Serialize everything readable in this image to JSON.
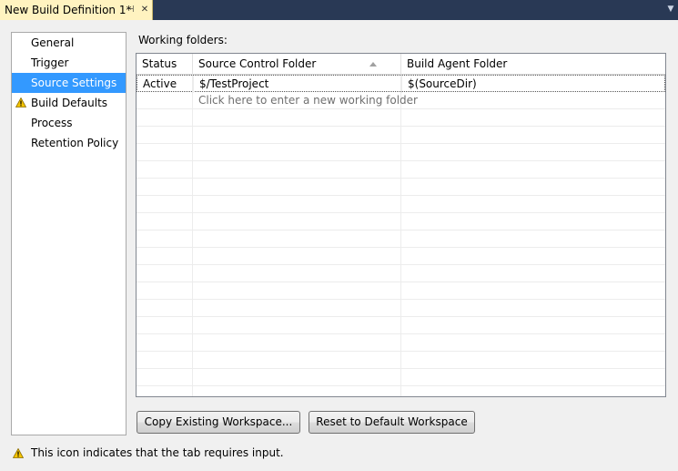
{
  "tab": {
    "title": "New Build Definition 1*",
    "pin_glyph": "⊣",
    "close_glyph": "✕",
    "dropdown_glyph": "▼"
  },
  "nav": {
    "items": [
      {
        "label": "General",
        "warning": false,
        "selected": false
      },
      {
        "label": "Trigger",
        "warning": false,
        "selected": false
      },
      {
        "label": "Source Settings",
        "warning": false,
        "selected": true
      },
      {
        "label": "Build Defaults",
        "warning": true,
        "selected": false
      },
      {
        "label": "Process",
        "warning": false,
        "selected": false
      },
      {
        "label": "Retention Policy",
        "warning": false,
        "selected": false
      }
    ]
  },
  "working_folders": {
    "label": "Working folders:",
    "columns": [
      "Status",
      "Source Control Folder",
      "Build Agent Folder"
    ],
    "sorted_column": "Source Control Folder",
    "rows": [
      {
        "status": "Active",
        "source": "$/TestProject",
        "agent": "$(SourceDir)"
      }
    ],
    "new_row_prompt": "Click here to enter a new working folder"
  },
  "buttons": {
    "copy": "Copy Existing Workspace...",
    "reset": "Reset to Default Workspace"
  },
  "footer": {
    "note": "This icon indicates that the tab requires input."
  },
  "colors": {
    "tabstrip": "#293955",
    "active_tab": "#fff3c0",
    "selection": "#3399ff",
    "warning": "#f5c400"
  }
}
